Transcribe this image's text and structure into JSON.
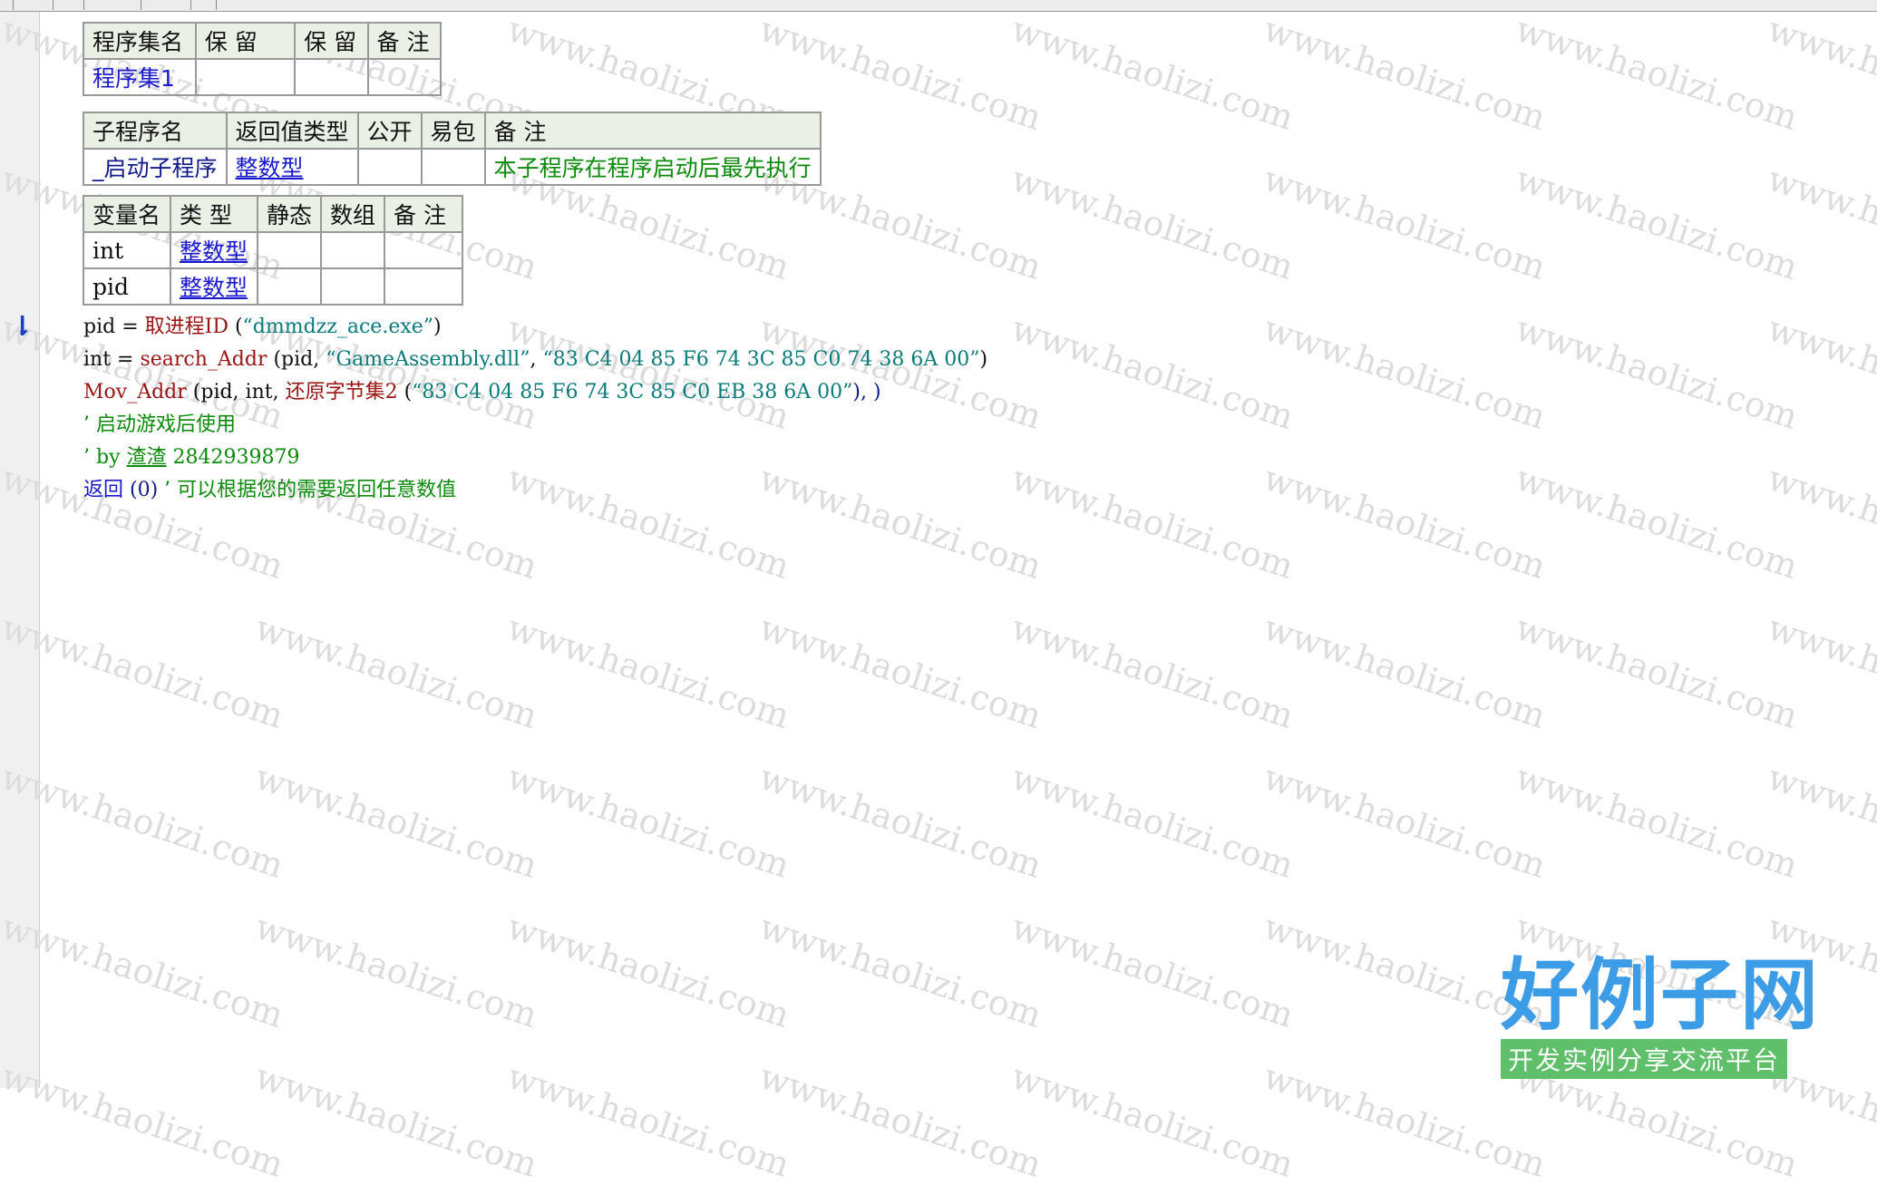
{
  "table_assembly": {
    "headers": [
      "程序集名",
      "保 留",
      "保 留",
      "备 注"
    ],
    "row": [
      "程序集1",
      "",
      "",
      ""
    ]
  },
  "table_subroutine": {
    "headers": [
      "子程序名",
      "返回值类型",
      "公开",
      "易包",
      "备 注"
    ],
    "row": [
      "_启动子程序",
      "整数型",
      "",
      "",
      "本子程序在程序启动后最先执行"
    ]
  },
  "table_variables": {
    "headers": [
      "变量名",
      "类 型",
      "静态",
      "数组",
      "备 注"
    ],
    "rows": [
      [
        "int",
        "整数型",
        "",
        "",
        ""
      ],
      [
        "pid",
        "整数型",
        "",
        "",
        ""
      ]
    ]
  },
  "code": {
    "l1": {
      "var": "pid",
      "eq": " = ",
      "func": "取进程ID",
      "open": " (",
      "arg": "“dmmdzz_ace.exe”",
      "close": ")"
    },
    "l2": {
      "var": "int",
      "eq": " = ",
      "func": "search_Addr",
      "open": " (pid, ",
      "arg1": "“GameAssembly.dll”",
      "sep": ", ",
      "arg2": "“83 C4 04 85 F6 74 3C 85 C0 74 38 6A 00”",
      "close": ")"
    },
    "l3": {
      "func": "Mov_Addr",
      "open": " (pid, int, ",
      "func2": "还原字节集2",
      "open2": " (",
      "arg": "“83 C4 04 85 F6 74 3C 85 C0 EB 38 6A 00”",
      "close": "), )"
    },
    "l4": {
      "comment": "’ 启动游戏后使用"
    },
    "l5": {
      "prefix": "’ by ",
      "name": "渣渣",
      "rest": " 2842939879"
    },
    "l6": {
      "kw": "返回",
      "val": " (0) ",
      "comment": "’ 可以根据您的需要返回任意数值"
    }
  },
  "watermark": "www.haolizi.com",
  "logo": {
    "title": "好例子网",
    "subtitle": "开发实例分享交流平台"
  },
  "colors": {
    "header_bg": "#eaf0e6",
    "type_link": "#1a1acc",
    "comment": "#0b8a0b",
    "function": "#9b1414",
    "string": "#0b7a7a"
  }
}
